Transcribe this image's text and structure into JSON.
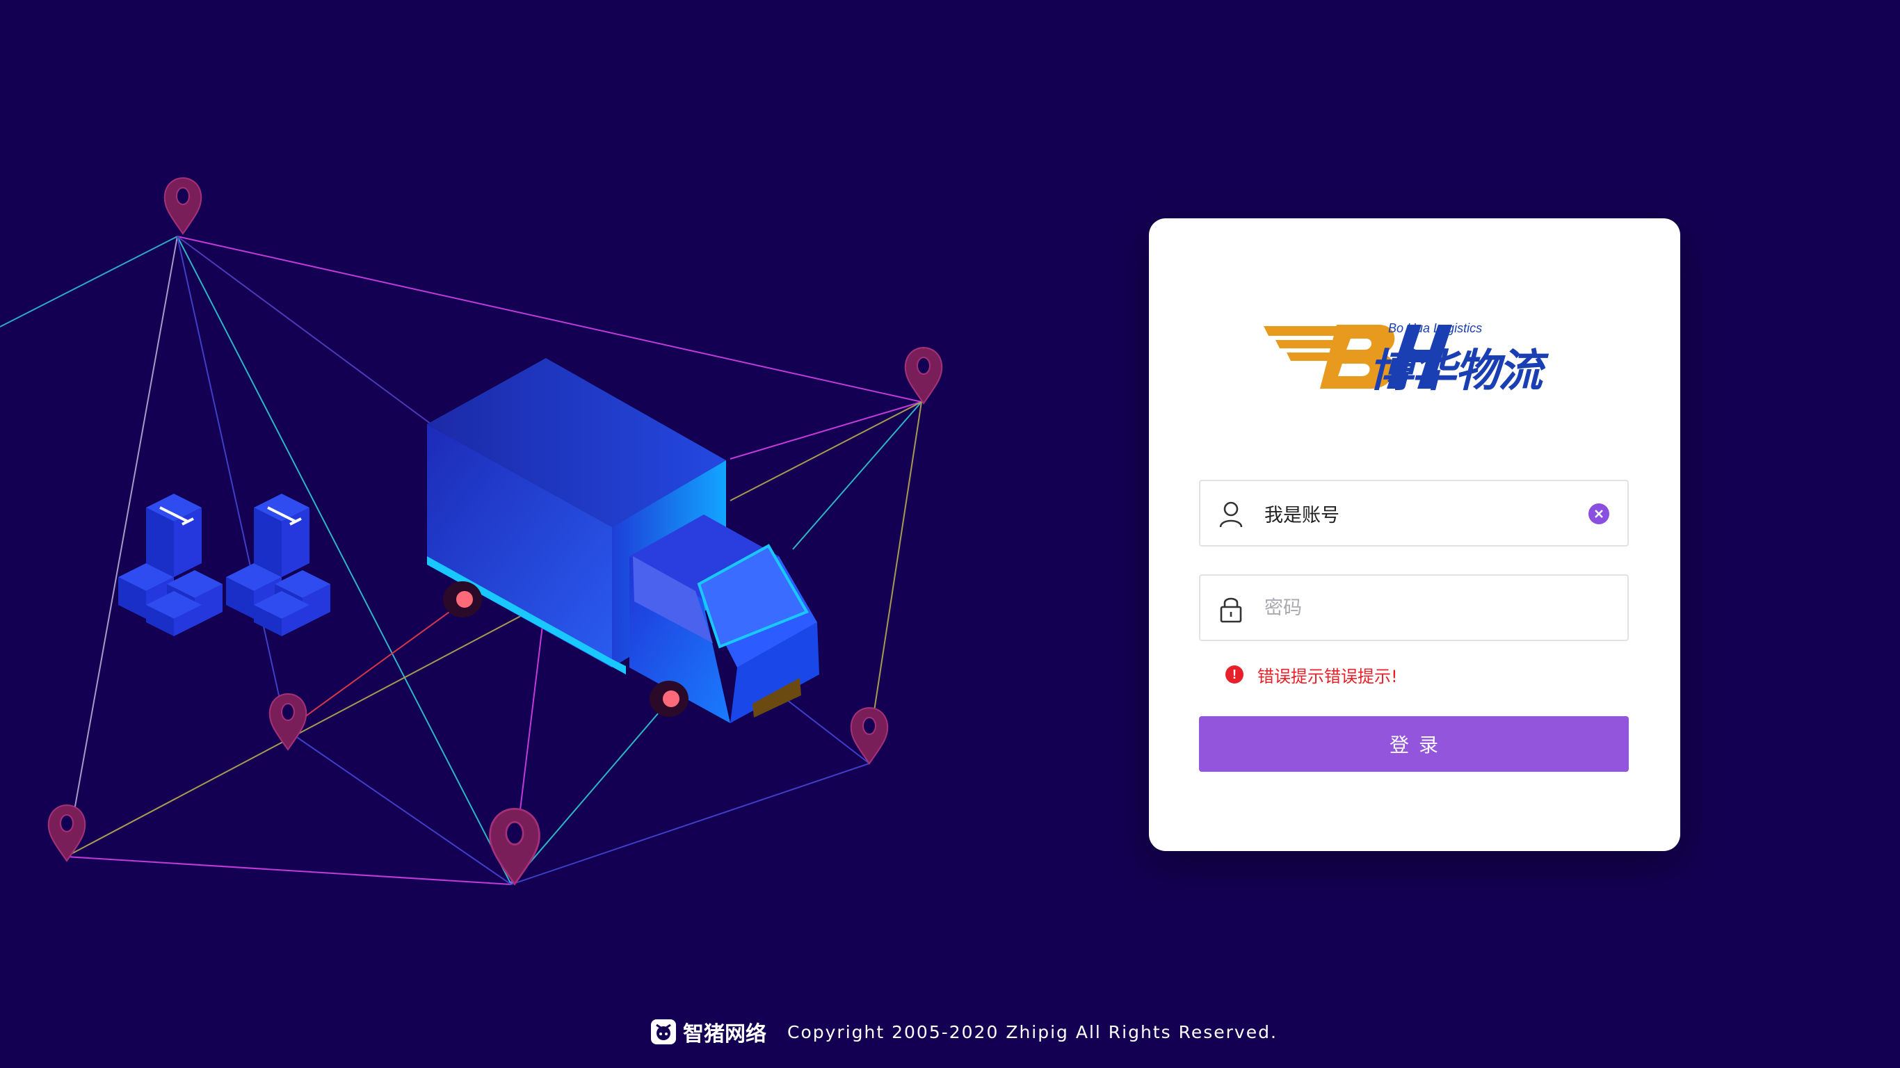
{
  "brand": {
    "logo_letters": "BH",
    "subtitle": "Bo Hua Logistics",
    "name_cn": "博华物流",
    "primary_color": "#1a3fb3",
    "accent_color": "#e89a1e"
  },
  "login": {
    "account": {
      "icon": "user-icon",
      "value": "我是账号",
      "clear_icon": "clear-icon"
    },
    "password": {
      "icon": "lock-icon",
      "placeholder": "密码",
      "value": ""
    },
    "error": {
      "icon": "error-icon",
      "symbol": "!",
      "text": "错误提示错误提示!"
    },
    "submit_label": "登录",
    "button_color": "#9355dc"
  },
  "footer": {
    "brand": "智猪网络",
    "copyright": "Copyright 2005-2020 Zhipig All Rights Reserved."
  },
  "colors": {
    "background": "#140052",
    "error": "#e8202a"
  }
}
